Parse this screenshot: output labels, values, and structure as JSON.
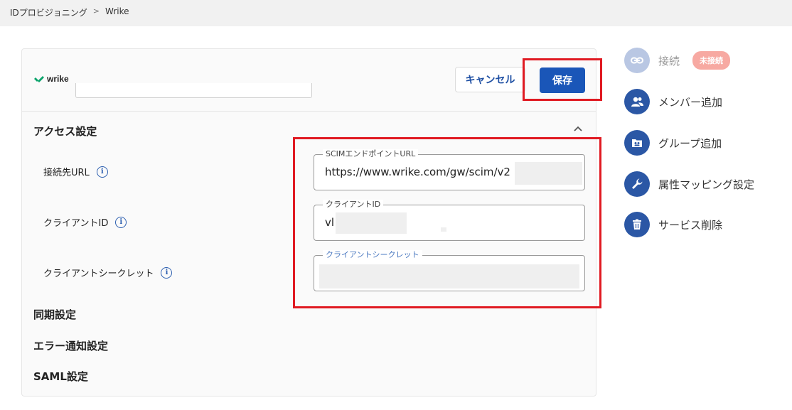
{
  "breadcrumb": {
    "items": [
      "IDプロビジョニング",
      "Wrike"
    ],
    "separator": ">"
  },
  "app": {
    "logo_text": "wrike"
  },
  "toolbar": {
    "cancel_label": "キャンセル",
    "save_label": "保存"
  },
  "sections": {
    "access": "アクセス設定",
    "sync": "同期設定",
    "error_notify": "エラー通知設定",
    "saml": "SAML設定"
  },
  "fields": {
    "url": {
      "label": "接続先URL",
      "input_label": "SCIMエンドポイントURL",
      "value": "https://www.wrike.com/gw/scim/v2"
    },
    "client_id": {
      "label": "クライアントID",
      "input_label": "クライアントID",
      "value": "vl"
    },
    "client_secret": {
      "label": "クライアントシークレット",
      "input_label": "クライアントシークレット",
      "value": ""
    }
  },
  "side_menu": {
    "connect": {
      "label": "接続",
      "badge": "未接続"
    },
    "add_member": {
      "label": "メンバー追加"
    },
    "add_group": {
      "label": "グループ追加"
    },
    "attr_mapping": {
      "label": "属性マッピング設定"
    },
    "delete_service": {
      "label": "サービス削除"
    }
  },
  "colors": {
    "primary": "#1a56b8",
    "highlight": "#e01a22",
    "badge": "#f7a9a2",
    "icon_bg": "#2b57a5"
  },
  "icons": [
    "link-icon",
    "members-icon",
    "group-icon",
    "wrench-icon",
    "trash-icon",
    "info-icon",
    "chevron-up-icon"
  ]
}
